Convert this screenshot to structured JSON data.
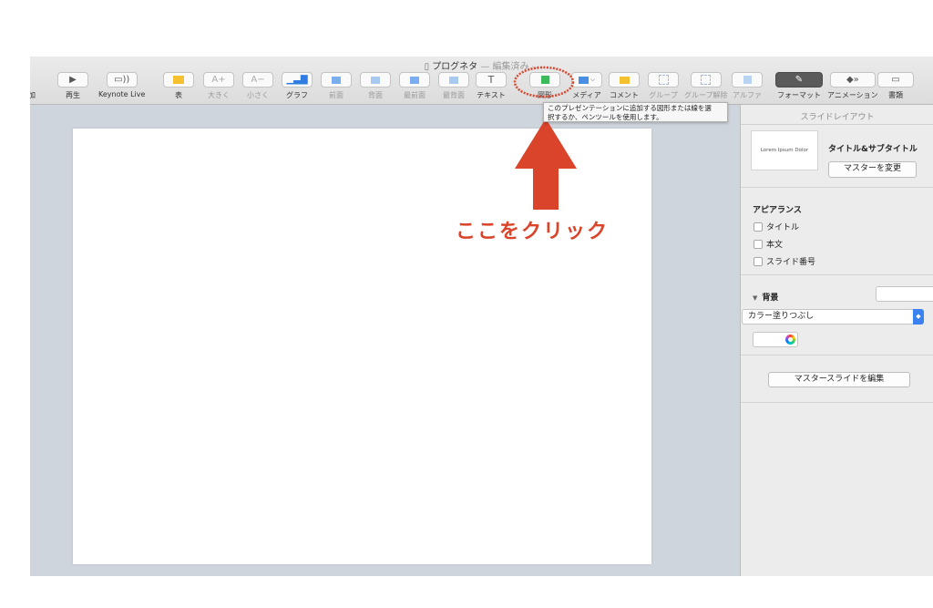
{
  "window": {
    "doc_name": "プログネタ",
    "doc_status": "— 編集済み ⌵"
  },
  "toolbar": {
    "cut_label": "加",
    "play": "再生",
    "keynote_live": "Keynote Live",
    "table": "表",
    "bigger": "大きく",
    "smaller": "小さく",
    "chart": "グラフ",
    "front": "前面",
    "back": "背面",
    "frontmost": "最前面",
    "backmost": "最背面",
    "text": "テキスト",
    "shape": "図形",
    "media": "メディア",
    "comment": "コメント",
    "group": "グループ",
    "ungroup": "グループ解除",
    "alpha": "アルファ",
    "format": "フォーマット",
    "animate": "アニメーション",
    "document": "書類"
  },
  "tooltip": {
    "line1": "このプレゼンテーションに追加する図形または線を選",
    "line2": "択するか、ペンツールを使用します。"
  },
  "inspector": {
    "header": "スライドレイアウト",
    "thumb_text": "Lorem Ipsum Dolor",
    "layout_name": "タイトル&サブタイトル",
    "change_master": "マスターを変更",
    "appearance": "アピアランス",
    "check_title": "タイトル",
    "check_body": "本文",
    "check_slide_number": "スライド番号",
    "background": "背景",
    "fill_select": "カラー塗りつぶし",
    "edit_master": "マスタースライドを編集"
  },
  "annotation": {
    "click_here": "ここをクリック",
    "color": "#d9442b"
  },
  "icons": [
    "doc-icon",
    "play-icon",
    "live-icon",
    "table-icon",
    "font-bigger-icon",
    "font-smaller-icon",
    "chart-icon",
    "shape-icon",
    "media-icon",
    "comment-icon",
    "format-icon",
    "animate-icon",
    "document-icon"
  ]
}
